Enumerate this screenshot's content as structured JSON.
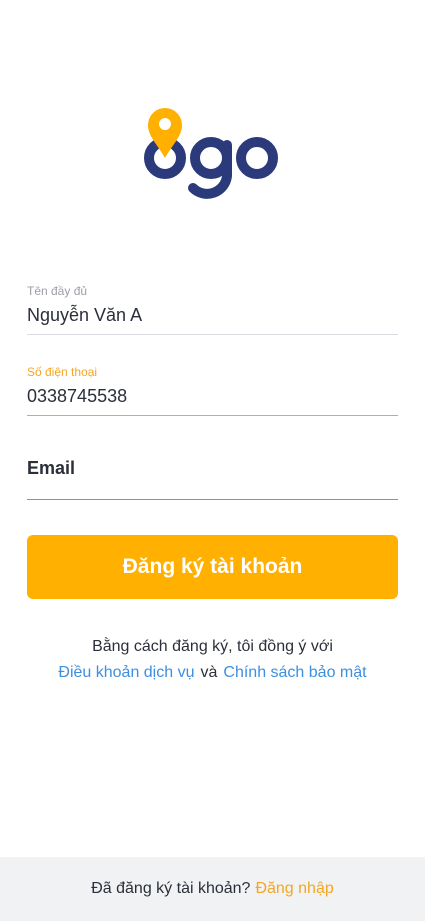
{
  "colors": {
    "brand_navy": "#2b3a7a",
    "brand_orange": "#ffb000",
    "link_blue": "#3d8fe0",
    "active_orange": "#f5a623"
  },
  "logo": {
    "icon": "location-pin-icon",
    "text": "ogo"
  },
  "form": {
    "full_name": {
      "label": "Tên đầy đủ",
      "value": "Nguyễn Văn A"
    },
    "phone": {
      "label": "Số điện thoại",
      "value": "0338745538"
    },
    "email": {
      "placeholder": "Email"
    },
    "submit_label": "Đăng ký tài khoản"
  },
  "terms": {
    "intro": "Bằng cách đăng ký, tôi đồng ý với",
    "terms_link": "Điều khoản dịch vụ",
    "conjunction": "và",
    "privacy_link": "Chính sách bảo mật"
  },
  "footer": {
    "prompt": "Đã đăng ký tài khoản?",
    "login_link": "Đăng nhập"
  }
}
